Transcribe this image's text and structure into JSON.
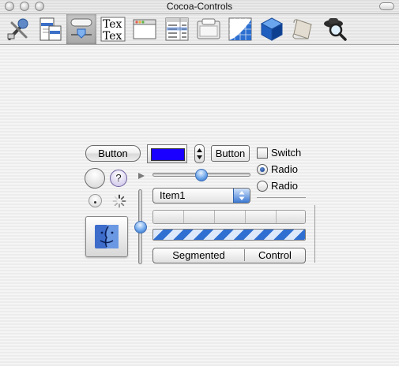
{
  "window": {
    "title": "Cocoa-Controls"
  },
  "toolbar": {
    "items": [
      {
        "icon": "app-prefs-icon"
      },
      {
        "icon": "menus-icon"
      },
      {
        "icon": "controls-icon",
        "selected": true
      },
      {
        "icon": "text-icon",
        "text_line1": "Tex",
        "text_line2": "Tex"
      },
      {
        "icon": "windows-icon"
      },
      {
        "icon": "data-table-icon"
      },
      {
        "icon": "containers-icon"
      },
      {
        "icon": "graphics-icon"
      },
      {
        "icon": "3d-cube-icon"
      },
      {
        "icon": "scroll-icon"
      },
      {
        "icon": "magnifier-icon"
      }
    ]
  },
  "controls": {
    "push_button_label": "Button",
    "color_well_color": "#1a00ff",
    "square_button_label": "Button",
    "switch_label": "Switch",
    "radio_1_label": "Radio",
    "radio_2_label": "Radio",
    "help_label": "?",
    "popup_value": "Item1",
    "segmented": [
      "Segmented",
      "Control"
    ],
    "slider_level": 0.5,
    "vertical_slider_level": 0.5,
    "radio_selected": 1,
    "switch_checked": false
  },
  "colors": {
    "accent": "#3a7ad8",
    "progress_light": "#dde9fb",
    "progress_dark": "#2f6fd2"
  }
}
